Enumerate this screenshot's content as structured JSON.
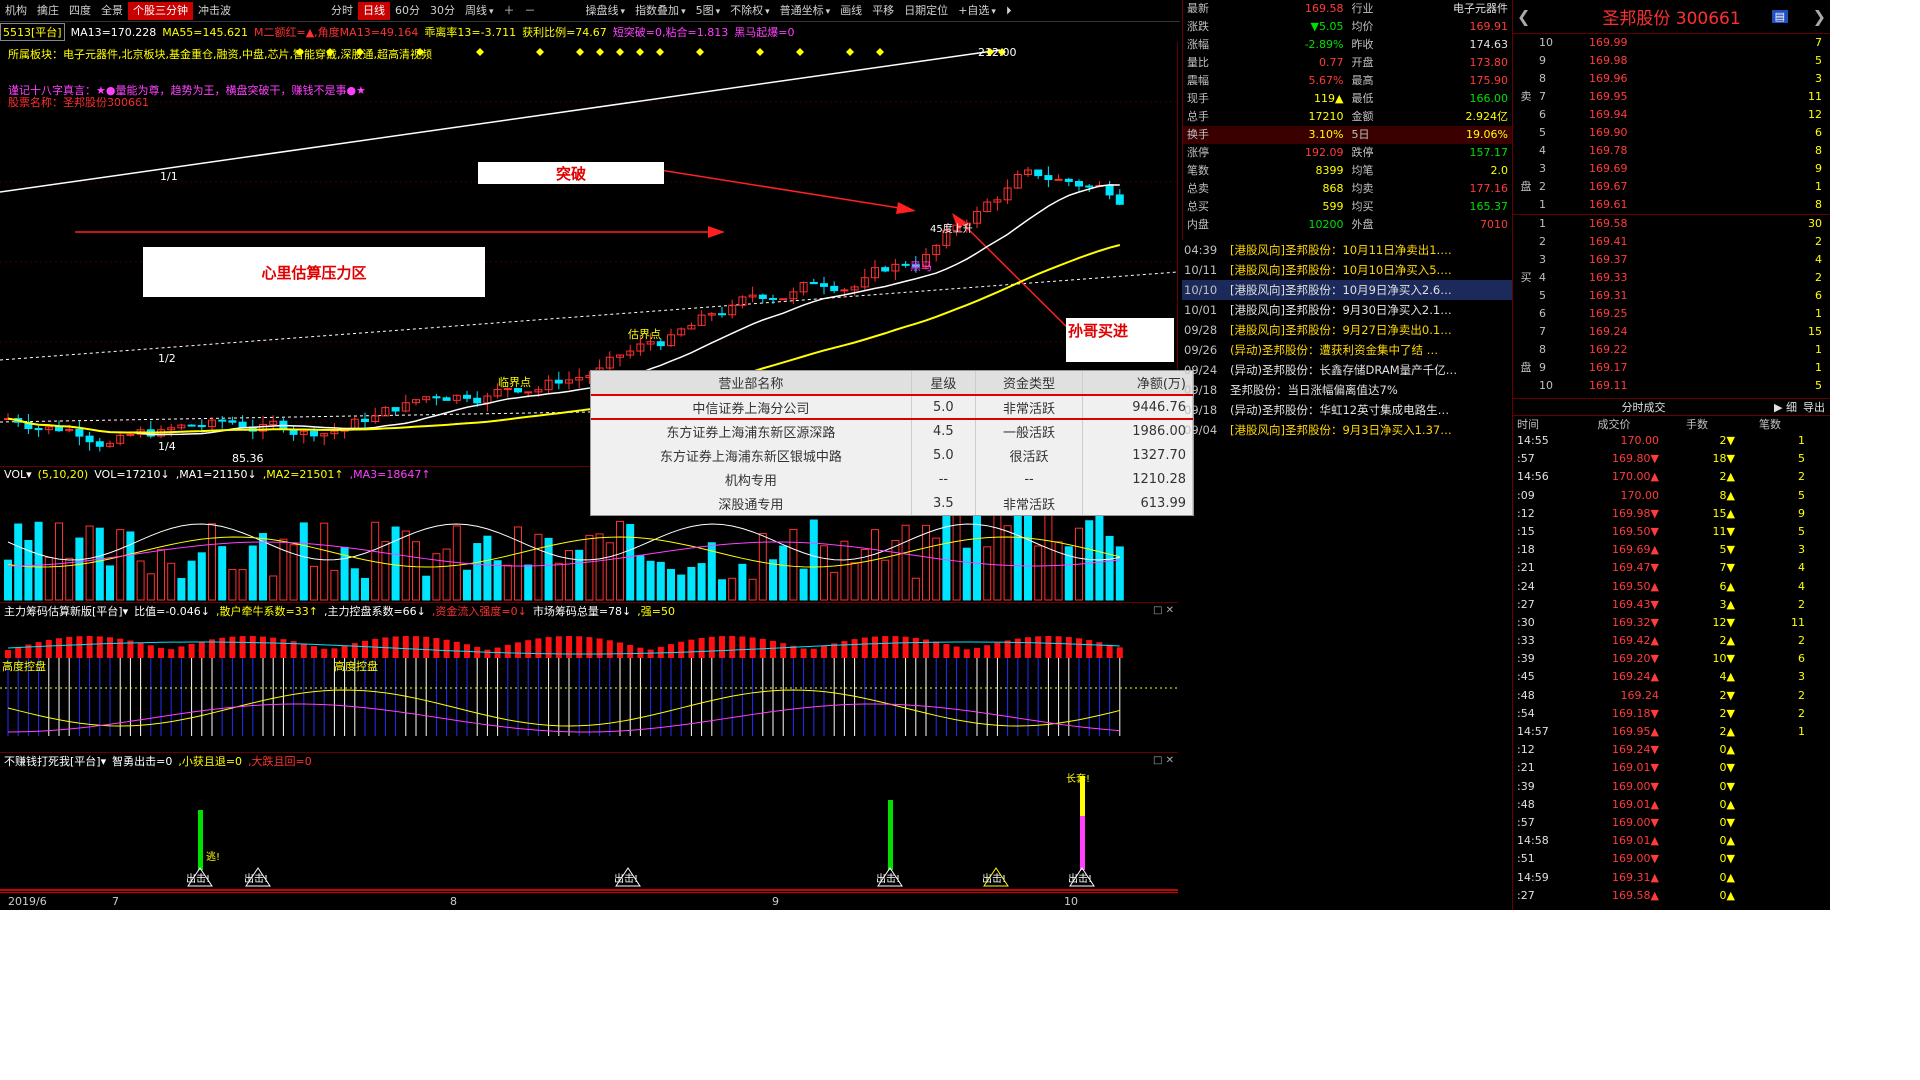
{
  "toolbar": {
    "items": [
      "机构",
      "擒庄",
      "四度",
      "全景",
      "个股三分钟",
      "冲击波"
    ],
    "active": "个股三分钟",
    "periods": [
      "分时",
      "日线",
      "60分",
      "30分",
      "周线"
    ],
    "active_period": "日线",
    "right": [
      "操盘线",
      "指数叠加",
      "5图",
      "不除权",
      "普通坐标",
      "画线",
      "平移",
      "日期定位",
      "+自选"
    ]
  },
  "ma_line": {
    "code": "5513[平台]",
    "ma13": "MA13=170.228",
    "ma55": "MA55=145.621",
    "ma_extra": "M二额红=▲,角度MA13=49.164",
    "deviation": "乖离率13=-3.711",
    "profit": "获利比例=74.67",
    "breakout": "短突破=0,粘合=1.813",
    "horse": "黑马起爆=0"
  },
  "main": {
    "sector_line": "所属板块：电子元器件,北京板块,基金重仓,融资,中盘,芯片,智能穿戴,深股通,超高清视频",
    "motto": "谨记十八字真言：★●量能为尊，趋势为王，横盘突破干，赚钱不是事●★",
    "stock_name_line": "股票名称：圣邦股份300661",
    "high_label": "212.00",
    "low_label": "85.36",
    "fib_1": "1/1",
    "fib_2": "1/2",
    "fib_4": "1/4",
    "label_gujiedian": "估界点",
    "label_heima": "黑马",
    "label_45": "45度上升",
    "label_jiangjie": "临界点",
    "note_tupo": "突破",
    "note_yali": "心里估算压力区",
    "note_sunge": "孙哥买进"
  },
  "chart_data": {
    "type": "candlestick",
    "x_ticks": [
      "2019/6",
      "7",
      "8",
      "9",
      "10"
    ],
    "price_high": 212.0,
    "price_low": 85.36,
    "last": 169.58
  },
  "volume": {
    "head": "VOL▾",
    "params": "(5,10,20)",
    "vol": "VOL=17210↓",
    "ma1": ",MA1=21150↓",
    "ma2": ",MA2=21501↑",
    "ma3": ",MA3=18647↑"
  },
  "ind1": {
    "name": "主力筹码估算新版[平台]▾",
    "ratio": "比值=-0.046↓",
    "retail": ",散户牵牛系数=33↑",
    "control": ",主力控盘系数=66↓",
    "inflow": ",资金流入强度=0↓",
    "total": "市场筹码总量=78↓",
    "rsi": ",强=50",
    "label_high": "高度控盘",
    "label_high2": "高度控盘"
  },
  "ind2": {
    "name": "不赚钱打死我[平台]▾",
    "attack": "智勇出击=0",
    "rise": ",小获且退=0",
    "fall": ",大跌且回=0",
    "chuji": "出击!",
    "changtao": "长套!",
    "tao": "逃!"
  },
  "quote": {
    "rows": [
      {
        "l1": "最新",
        "v1": "169.58",
        "c1": "",
        "l2": "行业",
        "v2": "电子元器件",
        "c2": "w"
      },
      {
        "l1": "涨跌",
        "v1": "▼5.05",
        "c1": "g",
        "l2": "均价",
        "v2": "169.91",
        "c2": ""
      },
      {
        "l1": "涨幅",
        "v1": "-2.89%",
        "c1": "g",
        "l2": "昨收",
        "v2": "174.63",
        "c2": "w"
      },
      {
        "l1": "量比",
        "v1": "0.77",
        "c1": "",
        "l2": "开盘",
        "v2": "173.80",
        "c2": ""
      },
      {
        "l1": "震幅",
        "v1": "5.67%",
        "c1": "",
        "l2": "最高",
        "v2": "175.90",
        "c2": ""
      },
      {
        "l1": "现手",
        "v1": "119▲",
        "c1": "y",
        "l2": "最低",
        "v2": "166.00",
        "c2": "g"
      },
      {
        "l1": "总手",
        "v1": "17210",
        "c1": "y",
        "l2": "金额",
        "v2": "2.924亿",
        "c2": "y"
      },
      {
        "l1": "换手",
        "v1": "3.10%",
        "c1": "y",
        "l2": "5日",
        "v2": "19.06%",
        "c2": "y"
      },
      {
        "l1": "涨停",
        "v1": "192.09",
        "c1": "",
        "l2": "跌停",
        "v2": "157.17",
        "c2": "g"
      },
      {
        "l1": "笔数",
        "v1": "8399",
        "c1": "y",
        "l2": "均笔",
        "v2": "2.0",
        "c2": "y"
      },
      {
        "l1": "总卖",
        "v1": "868",
        "c1": "y",
        "l2": "均卖",
        "v2": "177.16",
        "c2": ""
      },
      {
        "l1": "总买",
        "v1": "599",
        "c1": "y",
        "l2": "均买",
        "v2": "165.37",
        "c2": "g"
      },
      {
        "l1": "内盘",
        "v1": "10200",
        "c1": "g",
        "l2": "外盘",
        "v2": "7010",
        "c2": ""
      }
    ]
  },
  "news": [
    {
      "d": "04:39",
      "t": "[港股风向]圣邦股份：10月11日净卖出1.…",
      "c": ""
    },
    {
      "d": "10/11",
      "t": "[港股风向]圣邦股份：10月10日净买入5.…",
      "c": ""
    },
    {
      "d": "10/10",
      "t": "[港股风向]圣邦股份：10月9日净买入2.6…",
      "c": "w"
    },
    {
      "d": "10/01",
      "t": "[港股风向]圣邦股份：9月30日净买入2.1…",
      "c": "w"
    },
    {
      "d": "09/28",
      "t": "[港股风向]圣邦股份：9月27日净卖出0.1…",
      "c": ""
    },
    {
      "d": "09/26",
      "t": "(异动)圣邦股份：遭获利资金集中了结 …",
      "c": ""
    },
    {
      "d": "09/24",
      "t": "(异动)圣邦股份：长鑫存储DRAM量产千亿…",
      "c": "w"
    },
    {
      "d": "09/18",
      "t": "圣邦股份：当日涨幅偏离值达7%",
      "c": "w"
    },
    {
      "d": "09/18",
      "t": "(异动)圣邦股份：华虹12英寸集成电路生…",
      "c": "w"
    },
    {
      "d": "09/04",
      "t": "[港股风向]圣邦股份：9月3日净买入1.37…",
      "c": ""
    }
  ],
  "book": {
    "title": "圣邦股份 300661",
    "sell_label": "卖盘",
    "buy_label": "买盘",
    "sells": [
      {
        "l": "10",
        "p": "169.99",
        "q": "7"
      },
      {
        "l": "9",
        "p": "169.98",
        "q": "5"
      },
      {
        "l": "8",
        "p": "169.96",
        "q": "3"
      },
      {
        "l": "7",
        "p": "169.95",
        "q": "11"
      },
      {
        "l": "6",
        "p": "169.94",
        "q": "12"
      },
      {
        "l": "5",
        "p": "169.90",
        "q": "6"
      },
      {
        "l": "4",
        "p": "169.78",
        "q": "8"
      },
      {
        "l": "3",
        "p": "169.69",
        "q": "9"
      },
      {
        "l": "2",
        "p": "169.67",
        "q": "1"
      },
      {
        "l": "1",
        "p": "169.61",
        "q": "8"
      }
    ],
    "buys": [
      {
        "l": "1",
        "p": "169.58",
        "q": "30"
      },
      {
        "l": "2",
        "p": "169.41",
        "q": "2"
      },
      {
        "l": "3",
        "p": "169.37",
        "q": "4"
      },
      {
        "l": "4",
        "p": "169.33",
        "q": "2"
      },
      {
        "l": "5",
        "p": "169.31",
        "q": "6"
      },
      {
        "l": "6",
        "p": "169.25",
        "q": "1"
      },
      {
        "l": "7",
        "p": "169.24",
        "q": "15"
      },
      {
        "l": "8",
        "p": "169.22",
        "q": "1"
      },
      {
        "l": "9",
        "p": "169.17",
        "q": "1"
      },
      {
        "l": "10",
        "p": "169.11",
        "q": "5"
      }
    ],
    "ticks_title": "分时成交",
    "ticks_detail": "细",
    "ticks_export": "导出",
    "cols": [
      "时间",
      "成交价",
      "手数",
      "笔数"
    ],
    "ticks": [
      {
        "t": "14:55",
        "p": "170.00",
        "pc": "red",
        "v": "2▼",
        "vc": "green",
        "n": "1"
      },
      {
        "t": ":57",
        "p": "169.80▼",
        "pc": "red",
        "v": "18▼",
        "vc": "green",
        "n": "5"
      },
      {
        "t": "14:56",
        "p": "170.00▲",
        "pc": "red",
        "v": "2▲",
        "vc": "red",
        "n": "2"
      },
      {
        "t": ":09",
        "p": "170.00",
        "pc": "red",
        "v": "8▲",
        "vc": "red",
        "n": "5"
      },
      {
        "t": ":12",
        "p": "169.98▼",
        "pc": "red",
        "v": "15▲",
        "vc": "red",
        "n": "9"
      },
      {
        "t": ":15",
        "p": "169.50▼",
        "pc": "red",
        "v": "11▼",
        "vc": "green",
        "n": "5"
      },
      {
        "t": ":18",
        "p": "169.69▲",
        "pc": "red",
        "v": "5▼",
        "vc": "green",
        "n": "3"
      },
      {
        "t": ":21",
        "p": "169.47▼",
        "pc": "red",
        "v": "7▼",
        "vc": "green",
        "n": "4"
      },
      {
        "t": ":24",
        "p": "169.50▲",
        "pc": "red",
        "v": "6▲",
        "vc": "red",
        "n": "4"
      },
      {
        "t": ":27",
        "p": "169.43▼",
        "pc": "red",
        "v": "3▲",
        "vc": "red",
        "n": "2"
      },
      {
        "t": ":30",
        "p": "169.32▼",
        "pc": "red",
        "v": "12▼",
        "vc": "green",
        "n": "11"
      },
      {
        "t": ":33",
        "p": "169.42▲",
        "pc": "red",
        "v": "2▲",
        "vc": "red",
        "n": "2"
      },
      {
        "t": ":39",
        "p": "169.20▼",
        "pc": "red",
        "v": "10▼",
        "vc": "green",
        "n": "6"
      },
      {
        "t": ":45",
        "p": "169.24▲",
        "pc": "red",
        "v": "4▲",
        "vc": "red",
        "n": "3"
      },
      {
        "t": ":48",
        "p": "169.24",
        "pc": "red",
        "v": "2▼",
        "vc": "green",
        "n": "2"
      },
      {
        "t": ":54",
        "p": "169.18▼",
        "pc": "red",
        "v": "2▼",
        "vc": "green",
        "n": "2"
      },
      {
        "t": "14:57",
        "p": "169.95▲",
        "pc": "red",
        "v": "2▲",
        "vc": "red",
        "n": "1"
      },
      {
        "t": ":12",
        "p": "169.24▼",
        "pc": "red",
        "v": "0▲",
        "vc": "red",
        "n": ""
      },
      {
        "t": ":21",
        "p": "169.01▼",
        "pc": "red",
        "v": "0▼",
        "vc": "green",
        "n": ""
      },
      {
        "t": ":39",
        "p": "169.00▼",
        "pc": "red",
        "v": "0▼",
        "vc": "green",
        "n": ""
      },
      {
        "t": ":48",
        "p": "169.01▲",
        "pc": "red",
        "v": "0▲",
        "vc": "red",
        "n": ""
      },
      {
        "t": ":57",
        "p": "169.00▼",
        "pc": "red",
        "v": "0▼",
        "vc": "green",
        "n": ""
      },
      {
        "t": "14:58",
        "p": "169.01▲",
        "pc": "red",
        "v": "0▲",
        "vc": "red",
        "n": ""
      },
      {
        "t": ":51",
        "p": "169.00▼",
        "pc": "red",
        "v": "0▼",
        "vc": "green",
        "n": ""
      },
      {
        "t": "14:59",
        "p": "169.31▲",
        "pc": "red",
        "v": "0▲",
        "vc": "red",
        "n": ""
      },
      {
        "t": ":27",
        "p": "169.58▲",
        "pc": "red",
        "v": "0▲",
        "vc": "red",
        "n": ""
      }
    ]
  },
  "brokers": {
    "cols": [
      "营业部名称",
      "星级",
      "资金类型",
      "净额(万)"
    ],
    "rows": [
      {
        "name": "中信证券上海分公司",
        "star": "5.0",
        "type": "非常活跃",
        "amt": "9446.76"
      },
      {
        "name": "东方证券上海浦东新区源深路",
        "star": "4.5",
        "type": "一般活跃",
        "amt": "1986.00"
      },
      {
        "name": "东方证券上海浦东新区银城中路",
        "star": "5.0",
        "type": "很活跃",
        "amt": "1327.70"
      },
      {
        "name": "机构专用",
        "star": "--",
        "type": "--",
        "amt": "1210.28"
      },
      {
        "name": "深股通专用",
        "star": "3.5",
        "type": "非常活跃",
        "amt": "613.99"
      }
    ]
  }
}
